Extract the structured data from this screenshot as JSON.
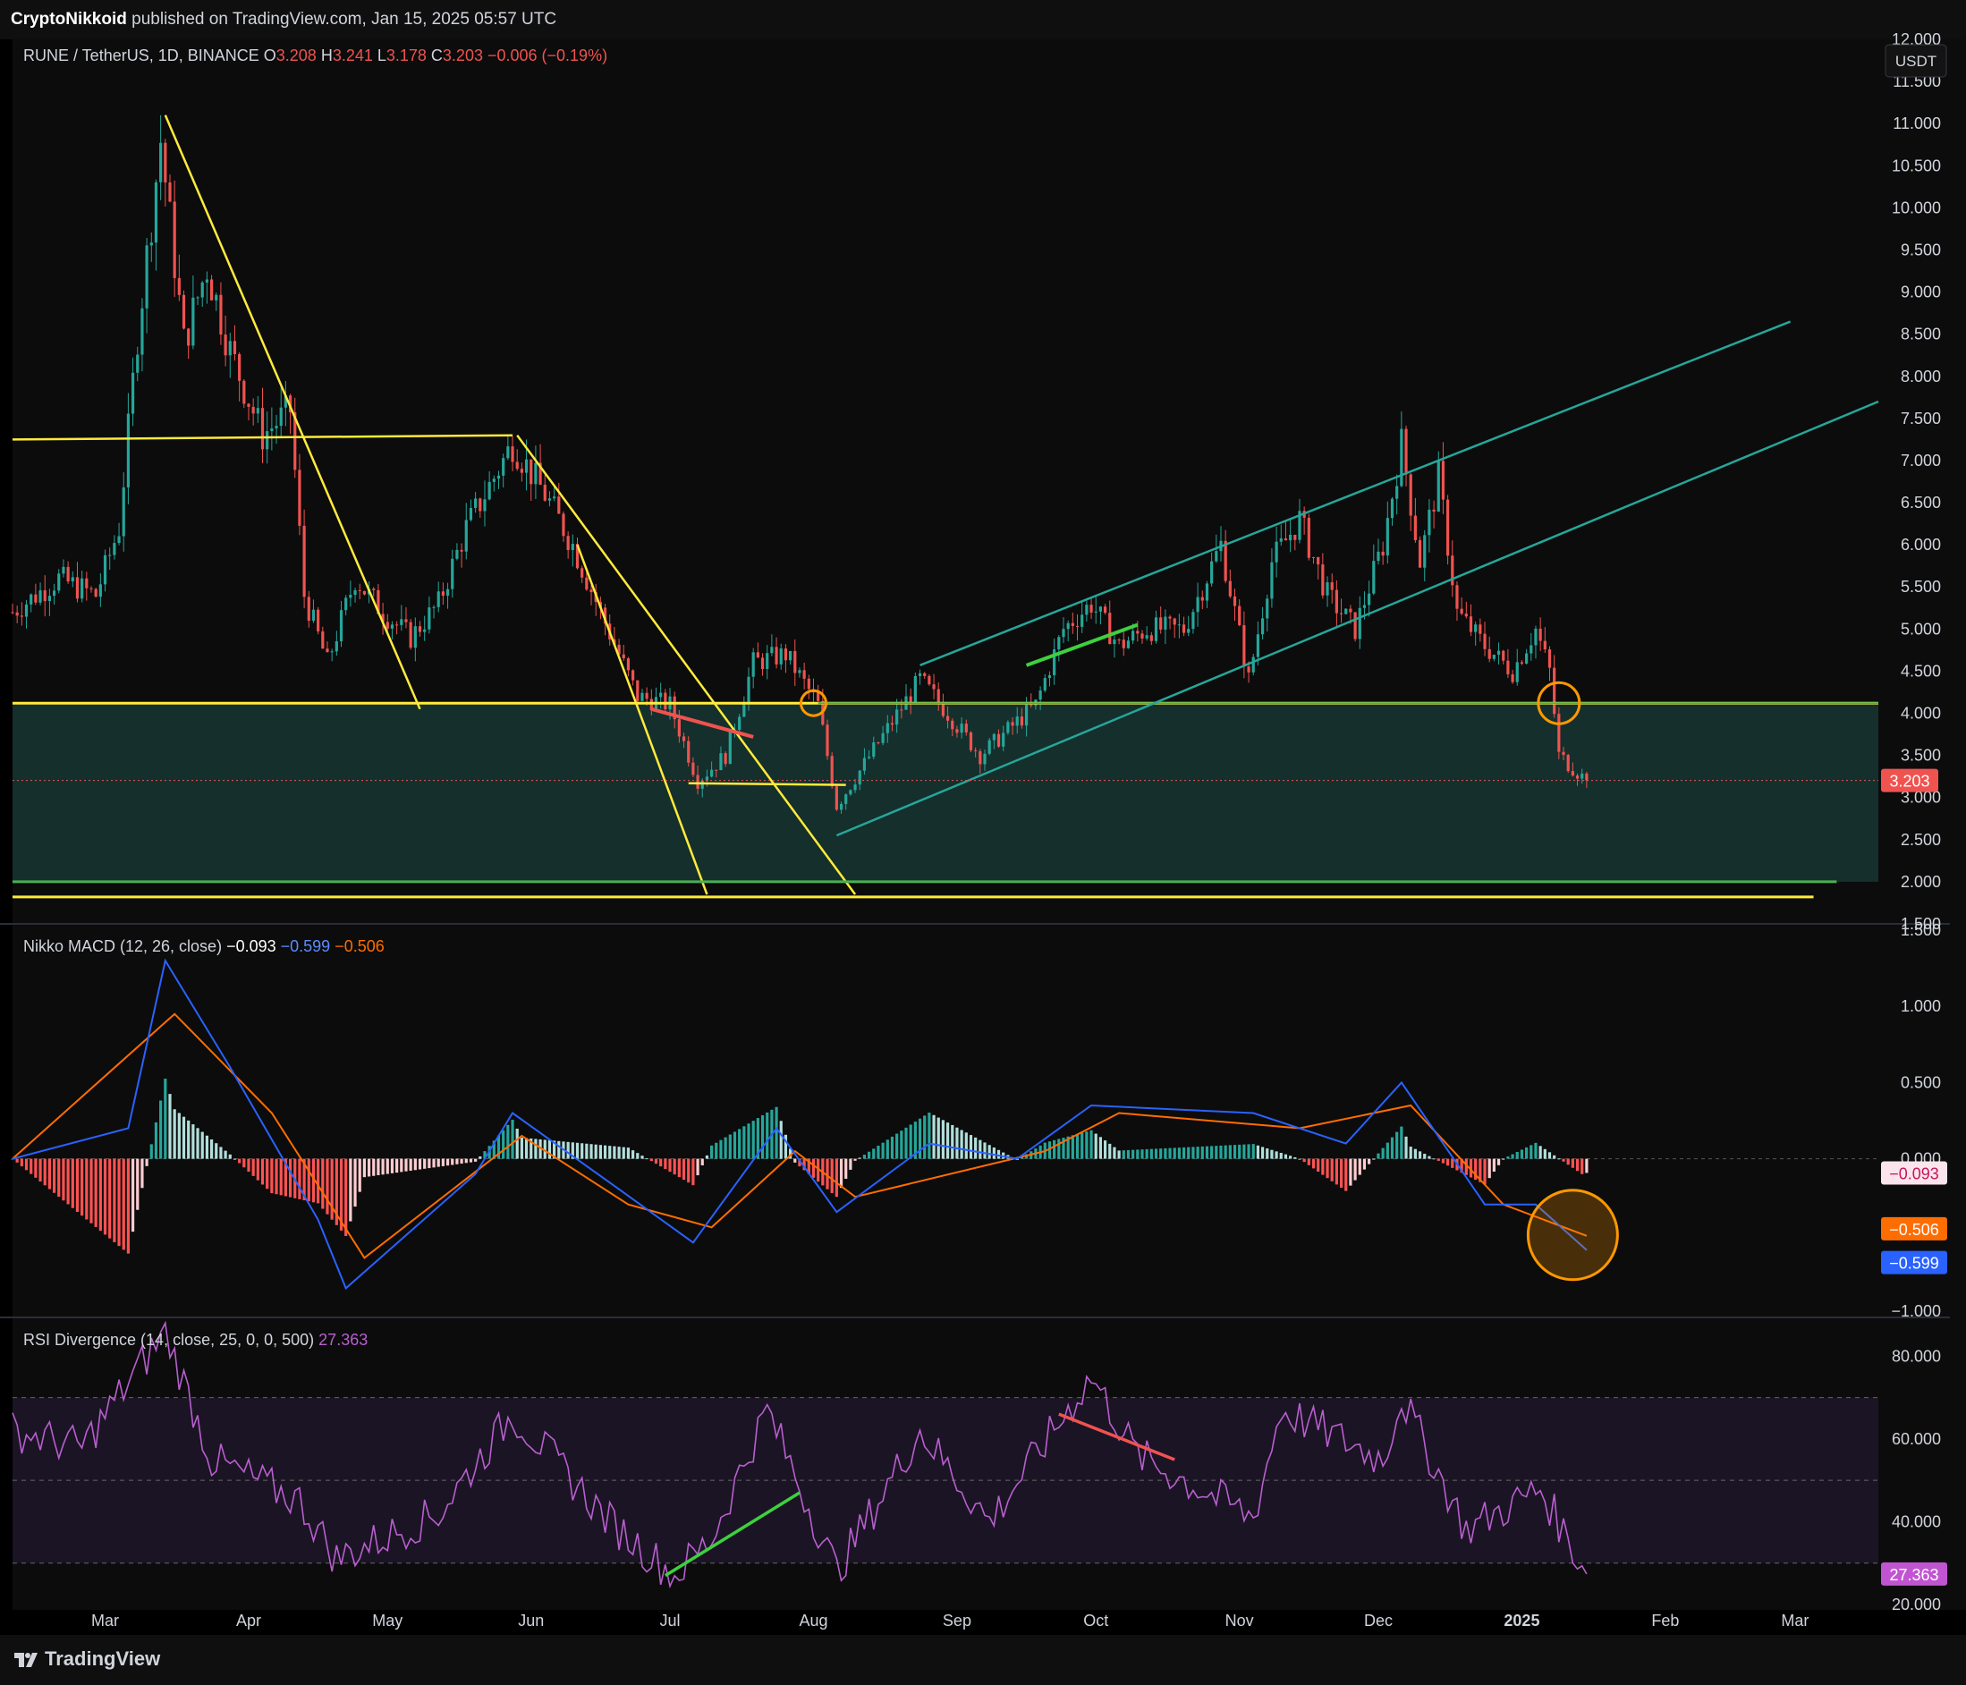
{
  "header": {
    "publisher": "CryptoNikkoid",
    "published_text": "published on TradingView.com, Jan 15, 2025 05:57 UTC"
  },
  "legend": {
    "symbol": "RUNE / TetherUS, 1D, BINANCE",
    "open_label": "O",
    "open": "3.208",
    "high_label": "H",
    "high": "3.241",
    "low_label": "L",
    "low": "3.178",
    "close_label": "C",
    "close": "3.203",
    "change": "−0.006 (−0.19%)"
  },
  "currency_button": "USDT",
  "price_axis": {
    "ticks": [
      "12.000",
      "11.500",
      "11.000",
      "10.500",
      "10.000",
      "9.500",
      "9.000",
      "8.500",
      "8.000",
      "7.500",
      "7.000",
      "6.500",
      "6.000",
      "5.500",
      "5.000",
      "4.500",
      "4.000",
      "3.500",
      "3.000",
      "2.500",
      "2.000",
      "1.500"
    ],
    "last_price_badge": "3.203"
  },
  "time_axis": {
    "ticks": [
      "Mar",
      "Apr",
      "May",
      "Jun",
      "Jul",
      "Aug",
      "Sep",
      "Oct",
      "Nov",
      "Dec",
      "2025",
      "Feb",
      "Mar"
    ]
  },
  "macd_panel": {
    "title": "Nikko MACD (12, 26, close)",
    "v1": "−0.093",
    "v2": "−0.599",
    "v3": "−0.506",
    "ticks": [
      "1.500",
      "1.000",
      "0.500",
      "0.000",
      "−1.000"
    ],
    "badges": [
      "−0.093",
      "−0.506",
      "−0.599"
    ]
  },
  "rsi_panel": {
    "title": "RSI Divergence (14, close, 25, 0, 0, 500)",
    "value": "27.363",
    "ticks": [
      "80.000",
      "60.000",
      "40.000",
      "20.000"
    ],
    "badge": "27.363"
  },
  "footer": {
    "brand": "TradingView"
  },
  "colors": {
    "up": "#26a69a",
    "down": "#ef5350",
    "trend_yellow": "#ffeb3b",
    "channel_teal": "#26a69a",
    "support_green": "#4caf50",
    "macd_line": "#2962ff",
    "signal_line": "#ff6d00",
    "rsi_line": "#b85fcf",
    "circle_orange": "#ff9800"
  },
  "chart_data": [
    {
      "type": "candlestick",
      "title": "RUNE / TetherUS, 1D, BINANCE",
      "x_range": [
        "2024-02-10",
        "2025-03-19"
      ],
      "ylim": [
        1.5,
        12.0
      ],
      "close_path": [
        {
          "x": "2024-02-10",
          "y": 5.2
        },
        {
          "x": "2024-02-20",
          "y": 5.6
        },
        {
          "x": "2024-02-28",
          "y": 5.4
        },
        {
          "x": "2024-03-04",
          "y": 6.2
        },
        {
          "x": "2024-03-08",
          "y": 8.5
        },
        {
          "x": "2024-03-13",
          "y": 10.8
        },
        {
          "x": "2024-03-18",
          "y": 8.4
        },
        {
          "x": "2024-03-23",
          "y": 9.3
        },
        {
          "x": "2024-03-28",
          "y": 8.3
        },
        {
          "x": "2024-04-04",
          "y": 7.3
        },
        {
          "x": "2024-04-10",
          "y": 7.6
        },
        {
          "x": "2024-04-13",
          "y": 5.4
        },
        {
          "x": "2024-04-18",
          "y": 4.6
        },
        {
          "x": "2024-04-24",
          "y": 5.6
        },
        {
          "x": "2024-04-30",
          "y": 5.2
        },
        {
          "x": "2024-05-06",
          "y": 4.9
        },
        {
          "x": "2024-05-12",
          "y": 5.3
        },
        {
          "x": "2024-05-18",
          "y": 6.2
        },
        {
          "x": "2024-05-24",
          "y": 6.8
        },
        {
          "x": "2024-05-28",
          "y": 7.2
        },
        {
          "x": "2024-06-04",
          "y": 6.6
        },
        {
          "x": "2024-06-10",
          "y": 6.0
        },
        {
          "x": "2024-06-16",
          "y": 5.2
        },
        {
          "x": "2024-06-24",
          "y": 4.2
        },
        {
          "x": "2024-07-01",
          "y": 4.1
        },
        {
          "x": "2024-07-07",
          "y": 3.2
        },
        {
          "x": "2024-07-13",
          "y": 3.5
        },
        {
          "x": "2024-07-19",
          "y": 4.6
        },
        {
          "x": "2024-07-26",
          "y": 4.7
        },
        {
          "x": "2024-08-02",
          "y": 4.1
        },
        {
          "x": "2024-08-06",
          "y": 2.9
        },
        {
          "x": "2024-08-12",
          "y": 3.4
        },
        {
          "x": "2024-08-18",
          "y": 3.9
        },
        {
          "x": "2024-08-24",
          "y": 4.4
        },
        {
          "x": "2024-08-30",
          "y": 4.0
        },
        {
          "x": "2024-09-06",
          "y": 3.5
        },
        {
          "x": "2024-09-12",
          "y": 3.8
        },
        {
          "x": "2024-09-18",
          "y": 4.1
        },
        {
          "x": "2024-09-24",
          "y": 5.0
        },
        {
          "x": "2024-09-30",
          "y": 5.3
        },
        {
          "x": "2024-10-06",
          "y": 4.8
        },
        {
          "x": "2024-10-12",
          "y": 5.0
        },
        {
          "x": "2024-10-20",
          "y": 5.0
        },
        {
          "x": "2024-10-28",
          "y": 6.0
        },
        {
          "x": "2024-11-03",
          "y": 4.4
        },
        {
          "x": "2024-11-08",
          "y": 5.8
        },
        {
          "x": "2024-11-14",
          "y": 6.3
        },
        {
          "x": "2024-11-20",
          "y": 5.4
        },
        {
          "x": "2024-11-26",
          "y": 5.0
        },
        {
          "x": "2024-12-02",
          "y": 6.0
        },
        {
          "x": "2024-12-06",
          "y": 7.2
        },
        {
          "x": "2024-12-10",
          "y": 5.8
        },
        {
          "x": "2024-12-14",
          "y": 6.8
        },
        {
          "x": "2024-12-18",
          "y": 5.2
        },
        {
          "x": "2024-12-24",
          "y": 4.8
        },
        {
          "x": "2024-12-30",
          "y": 4.5
        },
        {
          "x": "2025-01-04",
          "y": 5.0
        },
        {
          "x": "2025-01-07",
          "y": 4.5
        },
        {
          "x": "2025-01-09",
          "y": 3.5
        },
        {
          "x": "2025-01-15",
          "y": 3.203
        }
      ],
      "support_zone": [
        2.0,
        4.12
      ],
      "horizontal_levels": [
        7.25,
        4.12,
        3.17,
        2.0,
        1.82
      ]
    },
    {
      "type": "line",
      "title": "Nikko MACD (12, 26, close)",
      "ylim": [
        -1.0,
        1.5
      ],
      "series": [
        {
          "name": "MACD",
          "values_at": [
            {
              "x": "2024-02-10",
              "y": 0.0
            },
            {
              "x": "2024-03-06",
              "y": 0.2
            },
            {
              "x": "2024-03-14",
              "y": 1.3
            },
            {
              "x": "2024-03-28",
              "y": 0.6
            },
            {
              "x": "2024-04-16",
              "y": -0.4
            },
            {
              "x": "2024-04-22",
              "y": -0.85
            },
            {
              "x": "2024-05-20",
              "y": -0.1
            },
            {
              "x": "2024-05-28",
              "y": 0.3
            },
            {
              "x": "2024-06-20",
              "y": -0.2
            },
            {
              "x": "2024-07-06",
              "y": -0.55
            },
            {
              "x": "2024-07-24",
              "y": 0.2
            },
            {
              "x": "2024-08-06",
              "y": -0.35
            },
            {
              "x": "2024-08-26",
              "y": 0.1
            },
            {
              "x": "2024-09-14",
              "y": 0.0
            },
            {
              "x": "2024-09-30",
              "y": 0.35
            },
            {
              "x": "2024-11-04",
              "y": 0.3
            },
            {
              "x": "2024-11-24",
              "y": 0.1
            },
            {
              "x": "2024-12-06",
              "y": 0.5
            },
            {
              "x": "2024-12-24",
              "y": -0.3
            },
            {
              "x": "2025-01-04",
              "y": -0.3
            },
            {
              "x": "2025-01-15",
              "y": -0.599
            }
          ]
        },
        {
          "name": "Signal",
          "values_at": [
            {
              "x": "2024-02-10",
              "y": 0.0
            },
            {
              "x": "2024-03-16",
              "y": 0.95
            },
            {
              "x": "2024-04-06",
              "y": 0.3
            },
            {
              "x": "2024-04-26",
              "y": -0.65
            },
            {
              "x": "2024-05-30",
              "y": 0.15
            },
            {
              "x": "2024-06-22",
              "y": -0.3
            },
            {
              "x": "2024-07-10",
              "y": -0.45
            },
            {
              "x": "2024-07-28",
              "y": 0.05
            },
            {
              "x": "2024-08-10",
              "y": -0.25
            },
            {
              "x": "2024-09-20",
              "y": 0.05
            },
            {
              "x": "2024-10-06",
              "y": 0.3
            },
            {
              "x": "2024-11-14",
              "y": 0.2
            },
            {
              "x": "2024-12-08",
              "y": 0.35
            },
            {
              "x": "2024-12-28",
              "y": -0.3
            },
            {
              "x": "2025-01-15",
              "y": -0.506
            }
          ]
        }
      ],
      "histogram_last": -0.093
    },
    {
      "type": "line",
      "title": "RSI Divergence (14, close, 25, 0, 0, 500)",
      "ylim": [
        20,
        90
      ],
      "bands": [
        30,
        50,
        70
      ],
      "series": [
        {
          "name": "RSI",
          "values_at": [
            {
              "x": "2024-02-10",
              "y": 62
            },
            {
              "x": "2024-02-25",
              "y": 58
            },
            {
              "x": "2024-03-14",
              "y": 86
            },
            {
              "x": "2024-03-24",
              "y": 55
            },
            {
              "x": "2024-04-12",
              "y": 45
            },
            {
              "x": "2024-04-20",
              "y": 31
            },
            {
              "x": "2024-05-12",
              "y": 42
            },
            {
              "x": "2024-05-28",
              "y": 66
            },
            {
              "x": "2024-06-18",
              "y": 40
            },
            {
              "x": "2024-07-02",
              "y": 27
            },
            {
              "x": "2024-07-10",
              "y": 36
            },
            {
              "x": "2024-07-22",
              "y": 67
            },
            {
              "x": "2024-08-06",
              "y": 28
            },
            {
              "x": "2024-08-24",
              "y": 62
            },
            {
              "x": "2024-09-08",
              "y": 40
            },
            {
              "x": "2024-09-30",
              "y": 75
            },
            {
              "x": "2024-10-10",
              "y": 56
            },
            {
              "x": "2024-11-04",
              "y": 41
            },
            {
              "x": "2024-11-10",
              "y": 67
            },
            {
              "x": "2024-12-02",
              "y": 55
            },
            {
              "x": "2024-12-06",
              "y": 70
            },
            {
              "x": "2024-12-20",
              "y": 38
            },
            {
              "x": "2025-01-05",
              "y": 48
            },
            {
              "x": "2025-01-15",
              "y": 27.363
            }
          ]
        }
      ]
    }
  ]
}
